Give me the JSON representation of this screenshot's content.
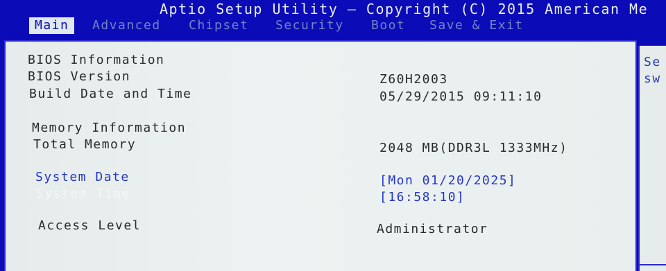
{
  "title": "Aptio Setup Utility – Copyright (C) 2015 American Me",
  "tabs": [
    {
      "label": "Main",
      "active": true
    },
    {
      "label": "Advanced",
      "active": false
    },
    {
      "label": "Chipset",
      "active": false
    },
    {
      "label": "Security",
      "active": false
    },
    {
      "label": "Boot",
      "active": false
    },
    {
      "label": "Save & Exit",
      "active": false
    }
  ],
  "main": {
    "bios_info_header": "BIOS Information",
    "bios_version_label": "BIOS Version",
    "bios_version_value": "Z60H2003",
    "build_date_label": "Build Date and Time",
    "build_date_value": "05/29/2015 09:11:10",
    "memory_info_header": "Memory Information",
    "total_memory_label": "Total Memory",
    "total_memory_value": "2048 MB(DDR3L 1333MHz)",
    "system_date_label": "System Date",
    "system_date_value": "[Mon 01/20/2025]",
    "system_time_label": "System Time",
    "system_time_value": "[16:58:10]",
    "access_level_label": "Access Level",
    "access_level_value": "Administrator"
  },
  "help": {
    "text": "Se\nsw"
  },
  "colors": {
    "background": "#0b0bb8",
    "panel": "#e6eceb",
    "selected_text": "#f4f6f6",
    "option_text": "#2636c8"
  }
}
